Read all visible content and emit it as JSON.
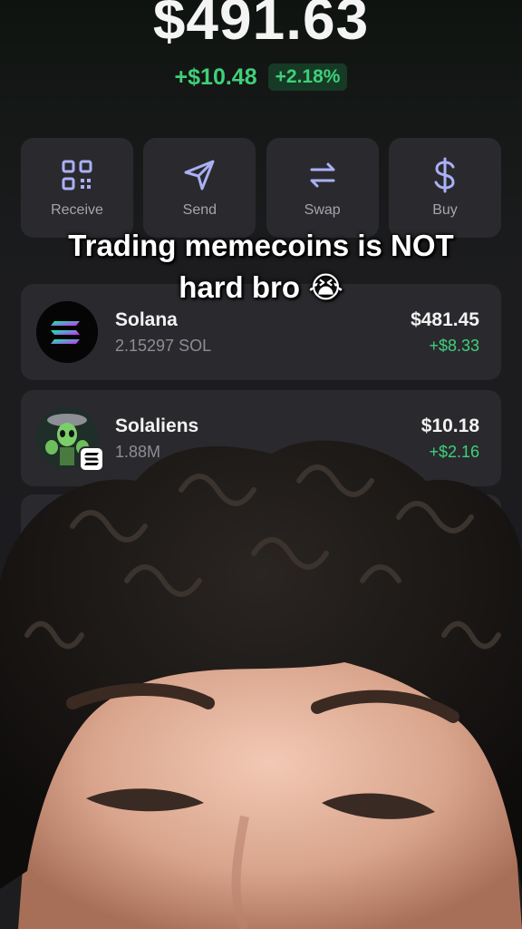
{
  "wallet": {
    "balance": "$491.63",
    "change_amount": "+$10.48",
    "change_percent": "+2.18%"
  },
  "actions": [
    {
      "label": "Receive",
      "icon": "qr-code-icon"
    },
    {
      "label": "Send",
      "icon": "send-icon"
    },
    {
      "label": "Swap",
      "icon": "swap-icon"
    },
    {
      "label": "Buy",
      "icon": "dollar-icon"
    }
  ],
  "caption": {
    "line1": "Trading memecoins is NOT",
    "line2": "hard bro 😭"
  },
  "tokens": [
    {
      "name": "Solana",
      "quantity": "2.15297 SOL",
      "value": "$481.45",
      "change": "+$8.33",
      "icon": "solana-logo"
    },
    {
      "name": "Solaliens",
      "quantity": "1.88M",
      "value": "$10.18",
      "change": "+$2.16",
      "icon": "alien-logo"
    }
  ],
  "colors": {
    "positive": "#3fd07a",
    "card": "#2a2a2e",
    "icon_purple": "#aab0f5"
  }
}
